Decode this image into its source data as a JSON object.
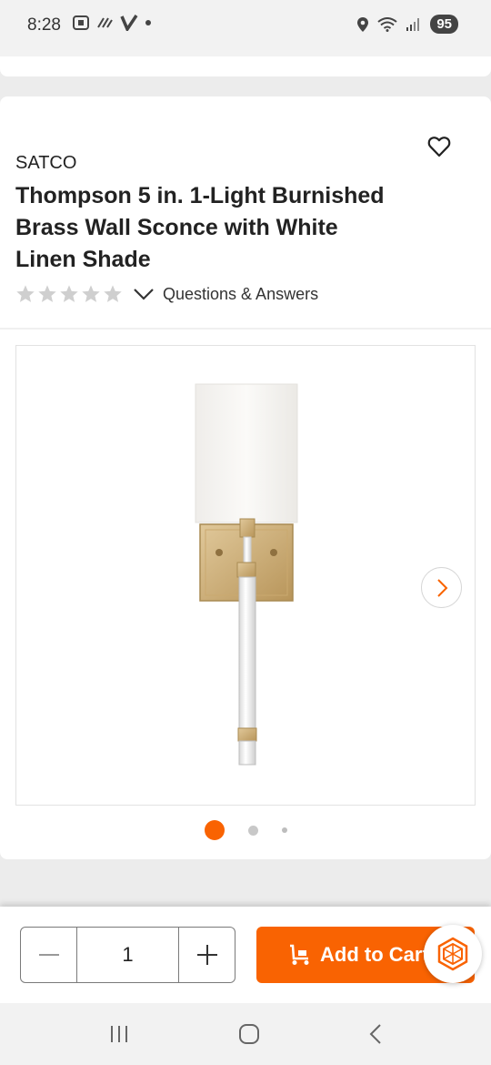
{
  "status_bar": {
    "time": "8:28",
    "battery": "95"
  },
  "product": {
    "brand": "SATCO",
    "title": "Thompson 5 in. 1-Light Burnished Brass Wall Sconce with White Linen Shade",
    "rating_stars": 0,
    "qa_label": "Questions & Answers"
  },
  "gallery": {
    "image_count": 3,
    "active_index": 0
  },
  "purchase": {
    "quantity": "1",
    "add_to_cart_label": "Add to Cart"
  },
  "colors": {
    "brand_orange": "#f96302",
    "brass": "#c8a96e",
    "shade": "#f7f6f3"
  }
}
